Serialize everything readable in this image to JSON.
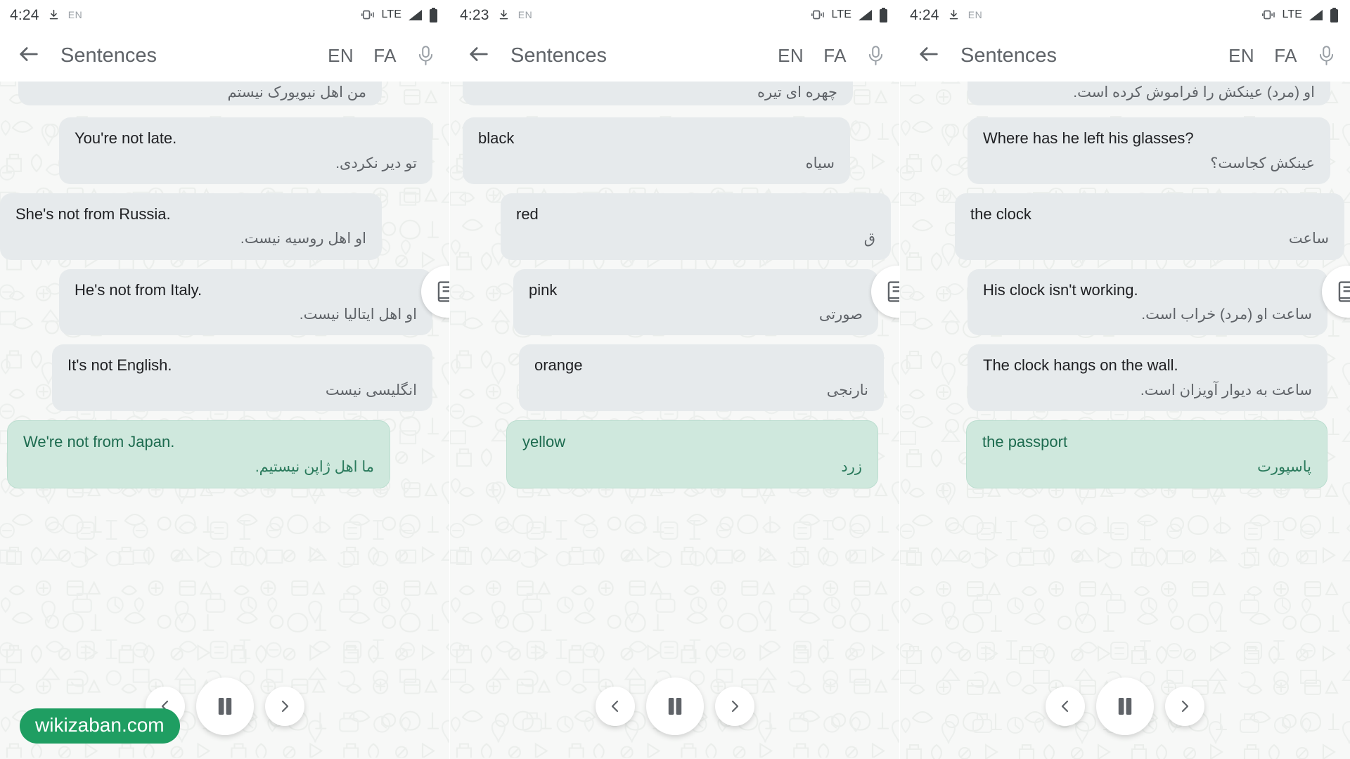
{
  "brand": {
    "accent_green": "#1f9e62",
    "bubble_gray": "#e6eaec",
    "bubble_highlight": "#cfe8dd",
    "chat_background": "#f7f8f7",
    "watermark": "wikizaban.com"
  },
  "screens": [
    {
      "statusbar": {
        "time": "4:24",
        "download_icon": "download-icon",
        "input_language": "EN",
        "vibrate_icon": "vibrate-icon",
        "network": "LTE",
        "signal_icon": "signal-icon",
        "battery_icon": "battery-full-icon"
      },
      "appbar": {
        "back_icon": "back-arrow-icon",
        "title": "Sentences",
        "lang_source": "EN",
        "lang_target": "FA",
        "mic_icon": "microphone-icon"
      },
      "dictionary_fab": "dictionary-book-icon",
      "cut_off_message": {
        "fa": "من اهل نیویورک نیستم"
      },
      "messages": [
        {
          "en": "You're not late.",
          "fa": "تو دیر نکردی.",
          "highlighted": false
        },
        {
          "en": "She's not from Russia.",
          "fa": "او اهل روسیه نیست.",
          "highlighted": false
        },
        {
          "en": "He's not from Italy.",
          "fa": "او اهل ایتالیا نیست.",
          "highlighted": false
        },
        {
          "en": "It's not English.",
          "fa": "انگلیسی نیست",
          "highlighted": false
        },
        {
          "en": "We're not from Japan.",
          "fa": "ما اهل ژاپن نیستیم.",
          "highlighted": true
        }
      ],
      "controls": {
        "previous": "previous-icon",
        "pause": "pause-icon",
        "next": "next-icon"
      },
      "watermark": "wikizaban.com"
    },
    {
      "statusbar": {
        "time": "4:23",
        "download_icon": "download-icon",
        "input_language": "EN",
        "vibrate_icon": "vibrate-icon",
        "network": "LTE",
        "signal_icon": "signal-icon",
        "battery_icon": "battery-full-icon"
      },
      "appbar": {
        "back_icon": "back-arrow-icon",
        "title": "Sentences",
        "lang_source": "EN",
        "lang_target": "FA",
        "mic_icon": "microphone-icon"
      },
      "dictionary_fab": "dictionary-book-icon",
      "cut_off_message": {
        "fa": "چهره ای تیره"
      },
      "messages": [
        {
          "en": "black",
          "fa": "سیاه",
          "highlighted": false
        },
        {
          "en": "red",
          "fa": "ق",
          "highlighted": false
        },
        {
          "en": "pink",
          "fa": "صورتی",
          "highlighted": false
        },
        {
          "en": "orange",
          "fa": "نارنجی",
          "highlighted": false
        },
        {
          "en": "yellow",
          "fa": "زرد",
          "highlighted": true
        }
      ],
      "controls": {
        "previous": "previous-icon",
        "pause": "pause-icon",
        "next": "next-icon"
      },
      "watermark": ""
    },
    {
      "statusbar": {
        "time": "4:24",
        "download_icon": "download-icon",
        "input_language": "EN",
        "vibrate_icon": "vibrate-icon",
        "network": "LTE",
        "signal_icon": "signal-icon",
        "battery_icon": "battery-full-icon"
      },
      "appbar": {
        "back_icon": "back-arrow-icon",
        "title": "Sentences",
        "lang_source": "EN",
        "lang_target": "FA",
        "mic_icon": "microphone-icon"
      },
      "dictionary_fab": "dictionary-book-icon",
      "cut_off_message": {
        "fa": "او (مرد) عینکش را فراموش کرده است."
      },
      "messages": [
        {
          "en": "Where has he left his glasses?",
          "fa": "عینکش کجاست؟",
          "highlighted": false
        },
        {
          "en": "the clock",
          "fa": "ساعت",
          "highlighted": false
        },
        {
          "en": "His clock isn't working.",
          "fa": "ساعت او (مرد) خراب است.",
          "highlighted": false
        },
        {
          "en": "The clock hangs on the wall.",
          "fa": "ساعت به دیوار آویزان است.",
          "highlighted": false
        },
        {
          "en": "the passport",
          "fa": "پاسپورت",
          "highlighted": true
        }
      ],
      "controls": {
        "previous": "previous-icon",
        "pause": "pause-icon",
        "next": "next-icon"
      },
      "watermark": ""
    }
  ]
}
